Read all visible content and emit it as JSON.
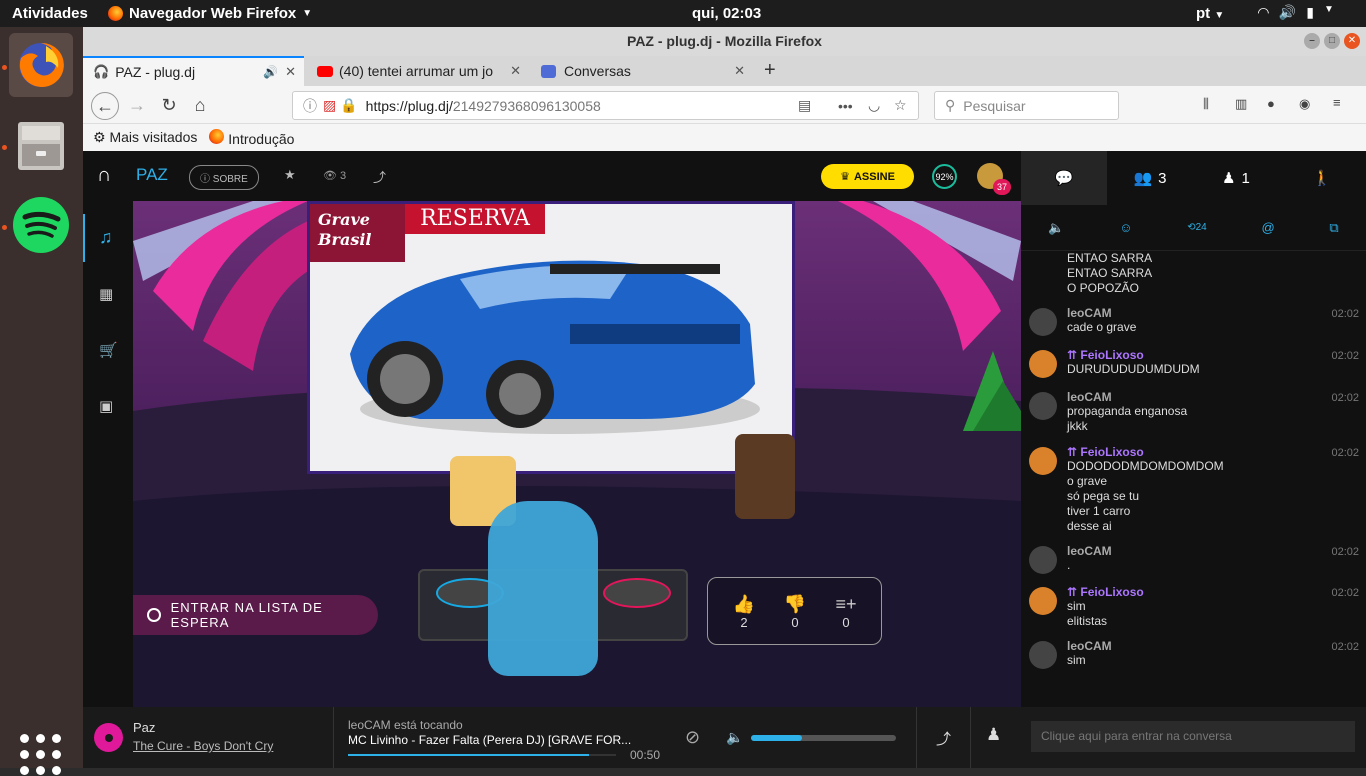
{
  "topbar": {
    "activities": "Atividades",
    "app_name": "Navegador Web Firefox",
    "clock": "qui, 02:03",
    "lang": "pt"
  },
  "window": {
    "title": "PAZ - plug.dj - Mozilla Firefox"
  },
  "tabs": [
    {
      "label": "PAZ - plug.dj"
    },
    {
      "label": "(40) tentei arrumar um jo"
    },
    {
      "label": "Conversas"
    }
  ],
  "url": {
    "host": "https://plug.dj/",
    "path": "2149279368096130058"
  },
  "search": {
    "placeholder": "Pesquisar"
  },
  "bookmarks": [
    {
      "label": "Mais visitados"
    },
    {
      "label": "Introdução"
    }
  ],
  "room": {
    "name": "PAZ",
    "about": "SOBRE",
    "viewers": "3",
    "subscribe": "ASSINE",
    "progress": "92%",
    "notifications": "37"
  },
  "stage": {
    "video_brand_left": "Grave Brasil",
    "video_brand_right": "RESERVA",
    "waitlist_button": "ENTRAR NA LISTA DE ESPERA",
    "votes": {
      "woot": "2",
      "meh": "0",
      "grab": "0"
    }
  },
  "sidebar": {
    "audience": "3",
    "waitlist": "1",
    "filters": {
      "history": "24"
    }
  },
  "chat": [
    {
      "user": "",
      "time": "",
      "lines": [
        "ENTAO SARRA",
        "ENTAO SARRA",
        "O POPOZÃO"
      ],
      "continuation": true
    },
    {
      "user": "leoCAM",
      "time": "02:02",
      "lines": [
        "cade o grave"
      ]
    },
    {
      "user": "FeioLixoso",
      "time": "02:02",
      "lines": [
        "DURUDUDUDUMDUDM"
      ],
      "staff": true
    },
    {
      "user": "leoCAM",
      "time": "02:02",
      "lines": [
        "propaganda enganosa",
        "jkkk"
      ]
    },
    {
      "user": "FeioLixoso",
      "time": "02:02",
      "lines": [
        "DODODODMDOMDOMDOM",
        "o grave",
        "só pega se tu",
        "tiver 1 carro",
        "desse ai"
      ],
      "staff": true
    },
    {
      "user": "leoCAM",
      "time": "02:02",
      "lines": [
        "."
      ]
    },
    {
      "user": "FeioLixoso",
      "time": "02:02",
      "lines": [
        "sim",
        "elitistas"
      ],
      "staff": true
    },
    {
      "user": "leoCAM",
      "time": "02:02",
      "lines": [
        "sim"
      ]
    }
  ],
  "bottom": {
    "playlist_name": "Paz",
    "playlist_track": "The Cure - Boys Don't Cry",
    "now_playing_dj": "leoCAM está tocando",
    "now_playing_track": "MC Livinho - Fazer Falta (Perera DJ) [GRAVE FOR...",
    "time_remaining": "00:50",
    "song_progress": 0.9,
    "volume": 0.35,
    "chat_placeholder": "Clique aqui para entrar na conversa"
  },
  "colors": {
    "accent_purple": "#ac76ff",
    "assine_yellow": "#ffdd00",
    "waitlist_magenta": "#5a1a4a",
    "ubuntu_orange": "#e95420",
    "spotify_green": "#1ed760"
  }
}
